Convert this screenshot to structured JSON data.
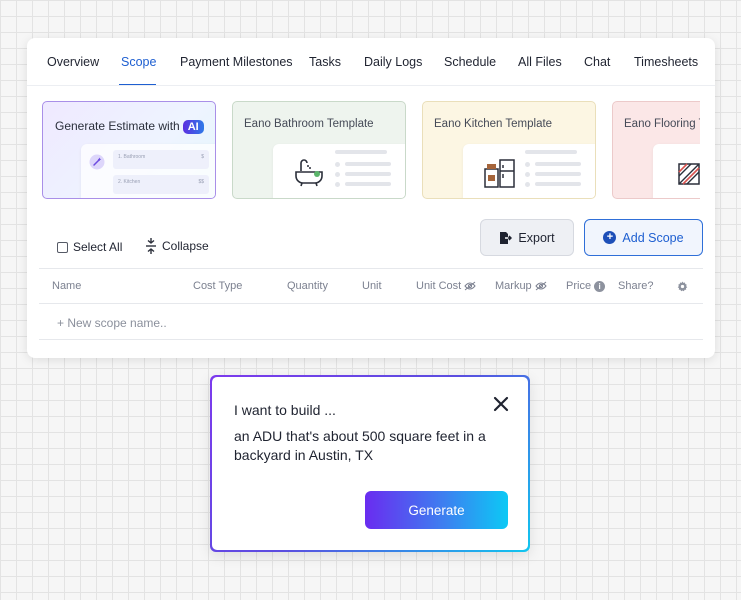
{
  "tabs": [
    {
      "label": "Overview"
    },
    {
      "label": "Scope"
    },
    {
      "label": "Payment Milestones"
    },
    {
      "label": "Tasks"
    },
    {
      "label": "Daily Logs"
    },
    {
      "label": "Schedule"
    },
    {
      "label": "All Files"
    },
    {
      "label": "Chat"
    },
    {
      "label": "Timesheets"
    }
  ],
  "active_tab": "Scope",
  "templates": {
    "ai": {
      "label": "Generate Estimate with",
      "badge": "AI",
      "mini_rows": [
        "1. Bathroom",
        "2. Kitchen"
      ],
      "mini_values": [
        "$",
        "$$"
      ]
    },
    "bathroom": {
      "label": "Eano Bathroom Template"
    },
    "kitchen": {
      "label": "Eano Kitchen Template"
    },
    "flooring": {
      "label": "Eano Flooring Template"
    }
  },
  "toolbar": {
    "select_all": "Select All",
    "collapse": "Collapse",
    "export": "Export",
    "add_scope": "Add Scope"
  },
  "table": {
    "columns": [
      "Name",
      "Cost Type",
      "Quantity",
      "Unit",
      "Unit Cost",
      "Markup",
      "Price",
      "Share?"
    ],
    "new_row_placeholder": "+ New scope name.."
  },
  "prompt": {
    "title": "I want to build ...",
    "text": "an ADU that's about 500 square feet in a backyard in Austin, TX",
    "generate": "Generate"
  },
  "colors": {
    "accent": "#1e5fd1",
    "gradient_start": "#6a2cf0",
    "gradient_end": "#0cc9f5"
  }
}
